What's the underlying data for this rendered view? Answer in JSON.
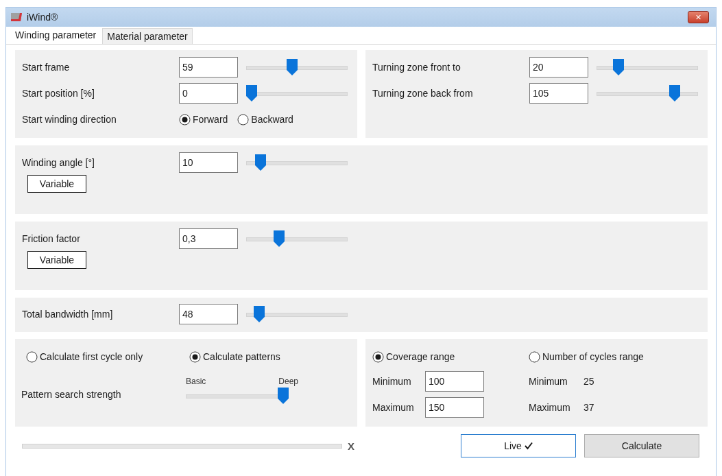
{
  "window": {
    "title": "iWind®",
    "close": "✕"
  },
  "tabs": [
    {
      "label": "Winding parameter",
      "selected": true
    },
    {
      "label": "Material parameter",
      "selected": false
    }
  ],
  "start": {
    "rows": [
      {
        "kind": "slider",
        "label": "Start frame",
        "value": "59",
        "level": 0.45
      },
      {
        "kind": "slider",
        "label": "Start position [%]",
        "value": "0",
        "level": 0
      },
      {
        "kind": "radio",
        "label": "Start winding direction",
        "options": [
          {
            "label": "Forward",
            "selected": true
          },
          {
            "label": "Backward",
            "selected": false
          }
        ]
      }
    ]
  },
  "turning": {
    "rows": [
      {
        "kind": "slider",
        "label": "Turning zone front to",
        "value": "20",
        "level": 0.18
      },
      {
        "kind": "slider",
        "label": "Turning zone back from",
        "value": "105",
        "level": 0.8
      }
    ]
  },
  "sections": [
    {
      "label": "Winding angle [°]",
      "value": "10",
      "level": 0.1,
      "button": "Variable"
    },
    {
      "label": "Friction factor",
      "value": "0,3",
      "level": 0.3,
      "button": "Variable"
    },
    {
      "label": "Total bandwidth [mm]",
      "value": "48",
      "level": 0.08
    }
  ],
  "calculation": {
    "modes": [
      {
        "label": "Calculate first cycle only",
        "selected": false
      },
      {
        "label": "Calculate patterns",
        "selected": true
      }
    ],
    "strength": {
      "label": "Pattern search strength",
      "min_label": "Basic",
      "max_label": "Deep",
      "level": 1
    }
  },
  "range": {
    "modes": [
      {
        "kind": "field",
        "label": "Coverage range",
        "selected": true,
        "minimum": {
          "label": "Minimum",
          "value": "100"
        },
        "maximum": {
          "label": "Maximum",
          "value": "150"
        }
      },
      {
        "kind": "text",
        "label": "Number of cycles range",
        "selected": false,
        "minimum": {
          "label": "Minimum",
          "value": "25"
        },
        "maximum": {
          "label": "Maximum",
          "value": "37"
        }
      }
    ]
  },
  "progress": {
    "cancel": "X"
  },
  "buttons": [
    {
      "label": "Live",
      "kind": "toggle",
      "checked": true
    },
    {
      "label": "Calculate",
      "kind": "plain"
    }
  ]
}
